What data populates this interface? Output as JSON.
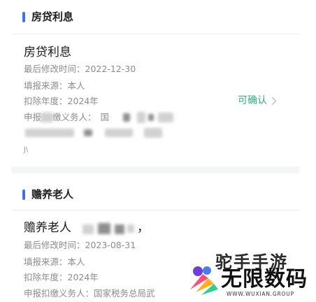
{
  "colors": {
    "accent": "#3d74e0",
    "confirm_green": "#2fb380",
    "chevron": "#bfbfbf"
  },
  "sections": [
    {
      "header": "房贷利息",
      "card": {
        "title": "房贷利息",
        "modified": "最后修改时间：2022-12-30",
        "source": "填报来源：本人",
        "year": "扣除年度：2024年",
        "withholder_partial_a": "申报",
        "withholder_partial_b": "缴义务人：",
        "withholder_partial_c": "国",
        "tail_char": "J\\",
        "action_label": "可确认",
        "action_icon": "chevron-right-icon"
      }
    },
    {
      "header": "赡养老人",
      "card": {
        "title": "赡养老人",
        "title_suffix": "，",
        "modified": "最后修改时间：2023-08-31",
        "source": "填报来源：本人",
        "year": "扣除年度：2024年",
        "withholder": "申报扣缴义务人：国家税务总局武"
      }
    }
  ],
  "watermark": {
    "top_text": "驼手手游",
    "main_text": "无限数码",
    "url_text": "WWW.WUXIAN.GROUP"
  }
}
